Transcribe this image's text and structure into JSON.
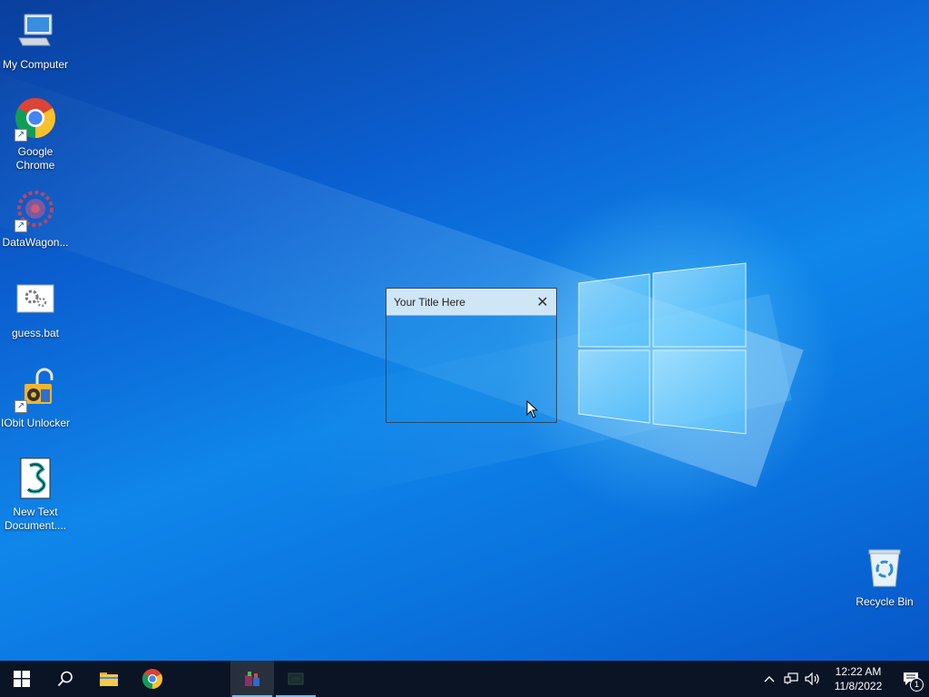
{
  "desktop": {
    "icons": [
      {
        "label": "My Computer",
        "icon": "computer-icon"
      },
      {
        "label": "Google Chrome",
        "icon": "chrome-icon"
      },
      {
        "label": "DataWagon...",
        "icon": "datawagon-icon"
      },
      {
        "label": "guess.bat",
        "icon": "batch-file-icon"
      },
      {
        "label": "IObit Unlocker",
        "icon": "iobit-unlocker-icon"
      },
      {
        "label": "New Text Document....",
        "icon": "text-document-icon"
      },
      {
        "label": "Recycle Bin",
        "icon": "recycle-bin-icon"
      }
    ]
  },
  "dialog": {
    "title": "Your Title Here",
    "close_glyph": "✕"
  },
  "taskbar": {
    "buttons": [
      {
        "name": "start-button",
        "icon": "windows-icon"
      },
      {
        "name": "search-button",
        "icon": "search-icon"
      },
      {
        "name": "file-explorer-button",
        "icon": "folder-icon"
      },
      {
        "name": "chrome-taskbar-button",
        "icon": "chrome-icon"
      },
      {
        "name": "app-taskbar-button-1",
        "icon": "app-icon"
      },
      {
        "name": "app-taskbar-button-2",
        "icon": "app-icon"
      }
    ],
    "tray": {
      "time": "12:22 AM",
      "date": "11/8/2022",
      "notification_count": "1"
    }
  },
  "colors": {
    "taskbar_bg": "#0b1424",
    "desktop_accent": "#0f86ea",
    "dialog_titlebar": "#cfe6f7"
  }
}
